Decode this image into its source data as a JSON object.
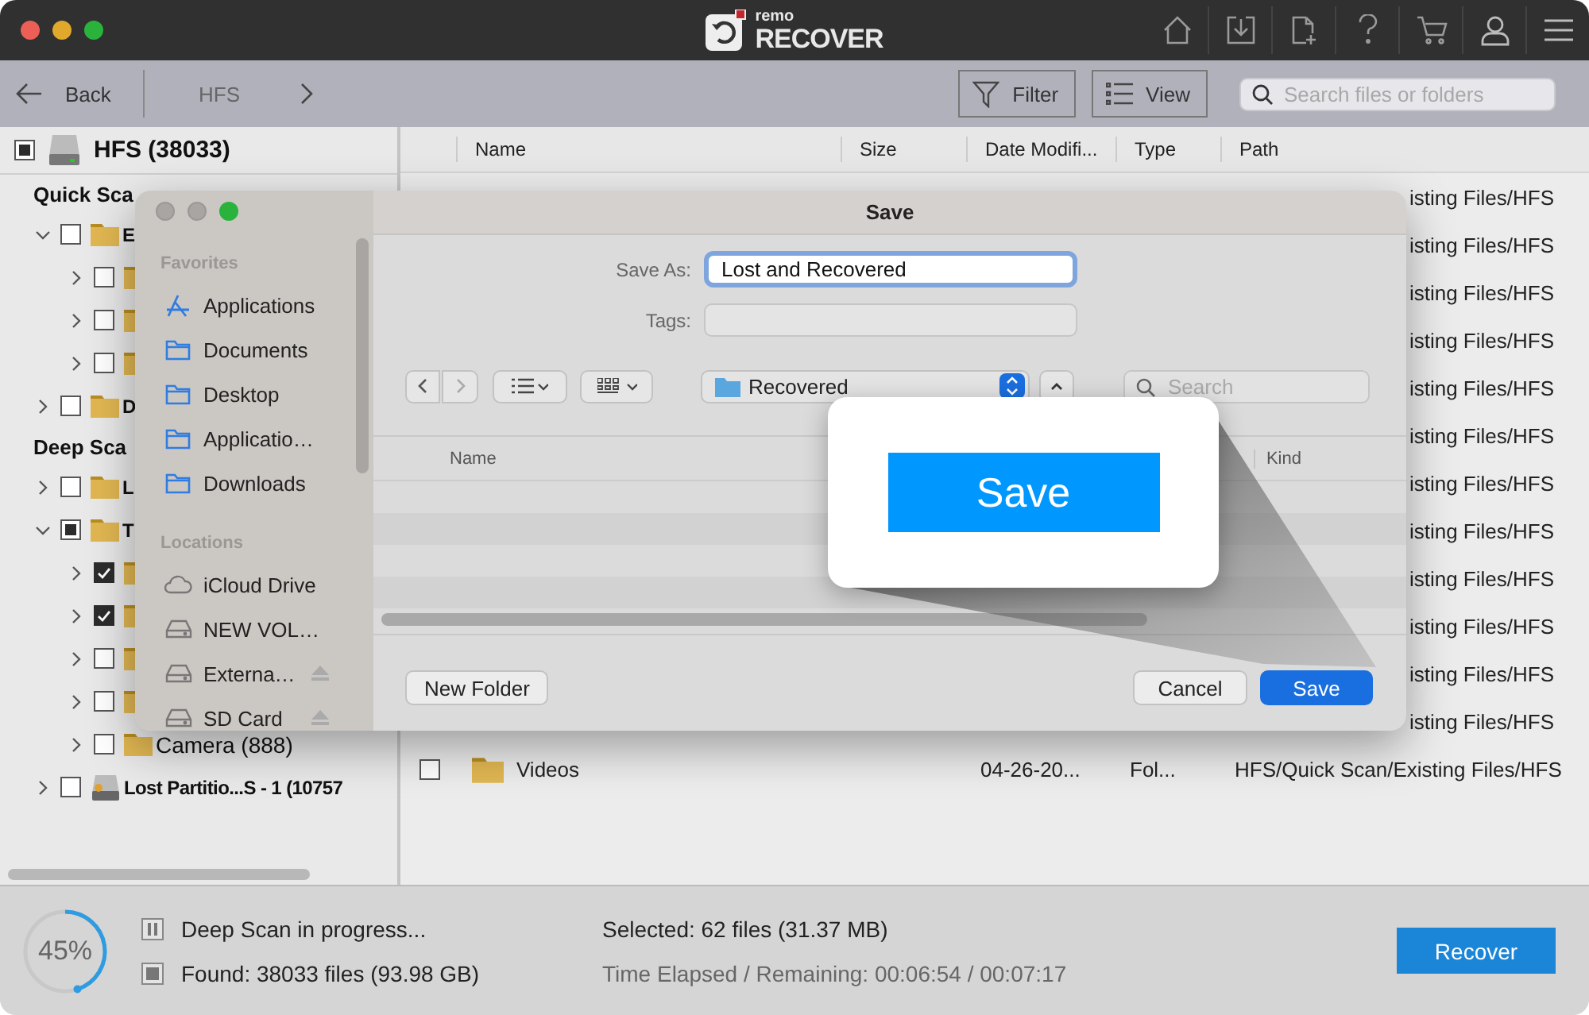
{
  "app": {
    "logo_small": "remo",
    "logo_large": "RECOVER"
  },
  "header_icons": [
    {
      "kind": "home"
    },
    {
      "kind": "download"
    },
    {
      "kind": "new-file"
    },
    {
      "kind": "help"
    },
    {
      "kind": "cart"
    },
    {
      "kind": "account"
    },
    {
      "kind": "menu"
    }
  ],
  "nav": {
    "back": "Back",
    "breadcrumb": "HFS",
    "filter": "Filter",
    "view": "View",
    "search": {
      "placeholder": "Search files or folders"
    }
  },
  "tree": {
    "root": {
      "label": "HFS (38033)",
      "checked": false,
      "partial": true
    },
    "sections": [
      {
        "title": "Quick Sca",
        "items": [
          {
            "label": "E",
            "checked": false,
            "partial": false,
            "expanded": true,
            "children": [
              {
                "checked": false,
                "partial": false,
                "expanded": false
              },
              {
                "checked": false,
                "partial": false,
                "expanded": false
              },
              {
                "checked": false,
                "partial": false,
                "expanded": false
              }
            ]
          },
          {
            "label": "D",
            "checked": false,
            "partial": false,
            "expanded": false
          }
        ]
      },
      {
        "title": "Deep Sca",
        "items": [
          {
            "label": "L",
            "checked": false,
            "partial": false,
            "expanded": false
          },
          {
            "label": "T",
            "checked": false,
            "partial": true,
            "expanded": true,
            "children": [
              {
                "checked": true,
                "partial": false,
                "expanded": false
              },
              {
                "checked": true,
                "partial": false,
                "expanded": false
              },
              {
                "checked": false,
                "partial": false,
                "expanded": false
              },
              {
                "checked": false,
                "partial": false,
                "expanded": false
              },
              {
                "label": "Camera (888)",
                "checked": false,
                "partial": false,
                "expanded": false
              }
            ]
          }
        ]
      }
    ],
    "drives": [
      {
        "label": "Lost Partitio...S - 1 (10757",
        "checked": false,
        "partial": false,
        "expanded": false
      }
    ]
  },
  "table": {
    "columns": [
      "Name",
      "Size",
      "Date Modifi...",
      "Type",
      "Path"
    ],
    "rows": [
      {
        "kind": "partial",
        "path": "isting Files/HFS"
      },
      {
        "kind": "partial",
        "path": "isting Files/HFS"
      },
      {
        "kind": "partial",
        "path": "isting Files/HFS"
      },
      {
        "kind": "partial",
        "path": "isting Files/HFS"
      },
      {
        "kind": "partial",
        "path": "isting Files/HFS"
      },
      {
        "kind": "partial",
        "path": "isting Files/HFS"
      },
      {
        "kind": "partial",
        "path": "isting Files/HFS"
      },
      {
        "kind": "partial",
        "path": "isting Files/HFS"
      },
      {
        "kind": "partial",
        "path": "isting Files/HFS"
      },
      {
        "kind": "partial",
        "path": "isting Files/HFS"
      },
      {
        "kind": "partial",
        "path": "isting Files/HFS"
      },
      {
        "kind": "partial",
        "path": "isting Files/HFS"
      },
      {
        "kind": "full",
        "checked": false,
        "name": "Videos",
        "date": "04-26-20...",
        "type": "Fol...",
        "path": "HFS/Quick Scan/Existing Files/HFS"
      }
    ]
  },
  "status": {
    "level": 0.45,
    "percent": "45%",
    "scan_state": "Deep Scan in progress...",
    "found": "Found: 38033 files (93.98 GB)",
    "selected": "Selected: 62 files (31.37 MB)",
    "time": "Time Elapsed / Remaining: 00:06:54 / 00:07:17",
    "recover": "Recover"
  },
  "save_dialog": {
    "title": "Save",
    "sidebar": [
      {
        "heading": "Favorites",
        "items": [
          {
            "label": "Applications",
            "kind": "apps",
            "eject": false
          },
          {
            "label": "Documents",
            "kind": "folder",
            "eject": false
          },
          {
            "label": "Desktop",
            "kind": "folder",
            "eject": false
          },
          {
            "label": "Applicatio…",
            "kind": "folder",
            "eject": false
          },
          {
            "label": "Downloads",
            "kind": "folder",
            "eject": false
          }
        ]
      },
      {
        "heading": "Locations",
        "items": [
          {
            "label": "iCloud Drive",
            "kind": "cloud",
            "eject": false
          },
          {
            "label": "NEW VOL…",
            "kind": "drive",
            "eject": false
          },
          {
            "label": "Externa…",
            "kind": "drive",
            "eject": true
          },
          {
            "label": "SD Card",
            "kind": "drive",
            "eject": true
          }
        ]
      }
    ],
    "save_as_label": "Save As:",
    "save_as_value": "Lost and Recovered",
    "tags_label": "Tags:",
    "location": "Recovered",
    "search": {
      "placeholder": "Search"
    },
    "columns": [
      "Name",
      "Kind"
    ],
    "buttons": {
      "new_folder": "New Folder",
      "cancel": "Cancel",
      "save": "Save"
    }
  },
  "callout": {
    "button": "Save"
  }
}
